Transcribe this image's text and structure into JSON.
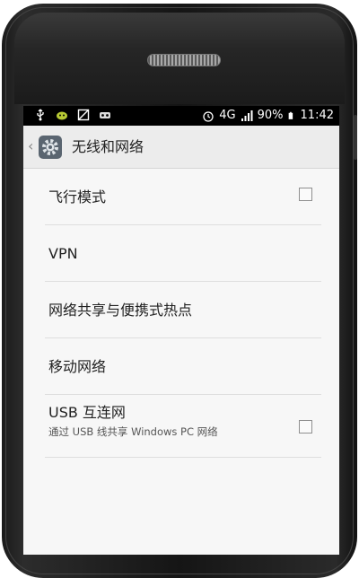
{
  "status_bar": {
    "network": "4G",
    "battery": "90%",
    "time": "11:42",
    "icons": [
      "usb-icon",
      "android-icon",
      "image-icon",
      "voicemail-icon",
      "alarm-icon",
      "signal-icon",
      "battery-icon"
    ]
  },
  "action_bar": {
    "title": "无线和网络",
    "icon": "settings-gear-icon"
  },
  "settings": [
    {
      "title": "飞行模式",
      "checkbox": true,
      "checked": false
    },
    {
      "title": "VPN"
    },
    {
      "title": "网络共享与便携式热点"
    },
    {
      "title": "移动网络"
    },
    {
      "title": "USB 互连网",
      "subtitle": "通过 USB 线共享 Windows PC 网络",
      "checkbox": true,
      "checked": false
    }
  ],
  "colors": {
    "background": "#f7f7f7",
    "status_bar": "#000000",
    "action_bar": "#ececec"
  }
}
